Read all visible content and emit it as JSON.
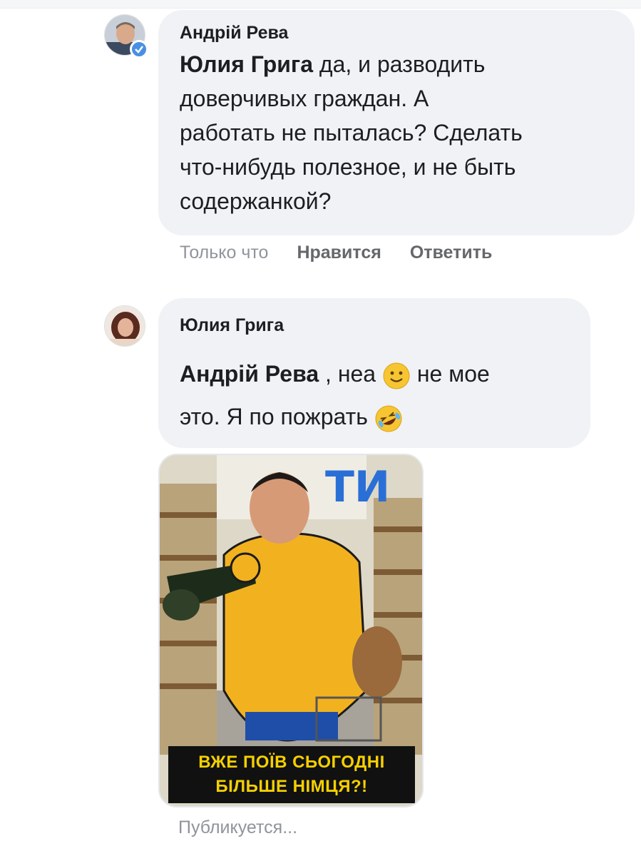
{
  "comments": [
    {
      "author": "Андрій Рева",
      "verified": true,
      "mention": "Юлия Грига",
      "lines": [
        "да, и разводить",
        "доверчивых граждан. А",
        "работать не пыталась? Сделать",
        "что-нибудь полезное, и не быть",
        "содержанкой?"
      ],
      "timestamp": "Только что",
      "like_label": "Нравится",
      "reply_label": "Ответить"
    },
    {
      "author": "Юлия Грига",
      "mention": "Андрій Рева",
      "line1_after_mention": " , неа ",
      "line1_end": " не мое",
      "line2": "это. Я по пожрать ",
      "emoji1": "slightly-smiling-face",
      "emoji2": "rolling-on-floor-laughing-face",
      "image": {
        "top_text": "ТИ",
        "caption_line1": "ВЖЕ ПОЇВ СЬОГОДНІ",
        "caption_line2": "БІЛЬШЕ НІМЦЯ?!"
      },
      "status": "Публикуется..."
    }
  ],
  "colors": {
    "bubble": "#f0f2f5",
    "meta": "#65676b",
    "verified": "#4a90e2",
    "caption_text": "#f5d000"
  }
}
